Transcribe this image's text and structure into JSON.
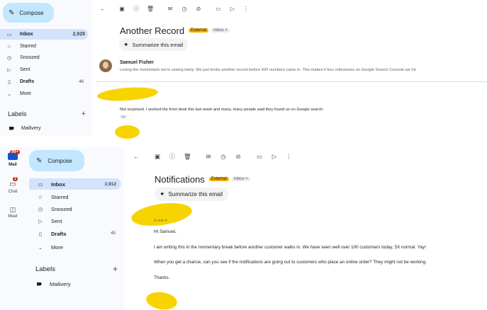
{
  "top": {
    "compose_label": "Compose",
    "nav": [
      {
        "label": "Inbox",
        "count": "2,928",
        "icon": "inbox-icon",
        "bold": true,
        "active": true
      },
      {
        "label": "Starred",
        "count": "",
        "icon": "star-icon"
      },
      {
        "label": "Snoozed",
        "count": "",
        "icon": "clock-icon"
      },
      {
        "label": "Sent",
        "count": "",
        "icon": "send-icon"
      },
      {
        "label": "Drafts",
        "count": "46",
        "icon": "draft-icon",
        "bold": true
      },
      {
        "label": "More",
        "count": "",
        "icon": "chevron-down-icon"
      }
    ],
    "labels_heading": "Labels",
    "label_item": "Mailivery",
    "subject": "Another Record",
    "badge_external": "External",
    "badge_inbox": "Inbox ×",
    "summarize": "Summarize this email",
    "sender_name": "Samuel Fisher",
    "snippet": "Loving the momentum we're seeing lately. We just broke another record before 420 numbers came in. This makes it four milestones on Google Search Console we hit",
    "reply_body": "Not surprised.  I worked the front desk this last week and many, many people said they found us on Google search.",
    "ellipsis": "•••"
  },
  "bottom": {
    "rail": [
      {
        "label": "Mail",
        "badge": "99+"
      },
      {
        "label": "Chat",
        "badge": "1"
      },
      {
        "label": "Meet",
        "badge": ""
      }
    ],
    "compose_label": "Compose",
    "nav": [
      {
        "label": "Inbox",
        "count": "2,912",
        "icon": "inbox-icon",
        "bold": true,
        "active": true
      },
      {
        "label": "Starred",
        "count": "",
        "icon": "star-icon"
      },
      {
        "label": "Snoozed",
        "count": "",
        "icon": "clock-icon"
      },
      {
        "label": "Sent",
        "count": "",
        "icon": "send-icon"
      },
      {
        "label": "Drafts",
        "count": "45",
        "icon": "draft-icon",
        "bold": true
      },
      {
        "label": "More",
        "count": "",
        "icon": "chevron-down-icon"
      }
    ],
    "labels_heading": "Labels",
    "label_item": "Mailivery",
    "subject": "Notifications",
    "badge_external": "External",
    "badge_inbox": "Inbox ×",
    "summarize": "Summarize this email",
    "to_me": "to me ▾",
    "greeting": "Hi Samuel,",
    "para1": "I am writing this in the momentary break before another customer walks in. We have seen well over 100 customers today, 5X normal.  Yay!",
    "para2": "When you get a chance, can you see if the notifications are going out to customers who place an online order?  They might not be working.",
    "signoff": "Thanks."
  }
}
